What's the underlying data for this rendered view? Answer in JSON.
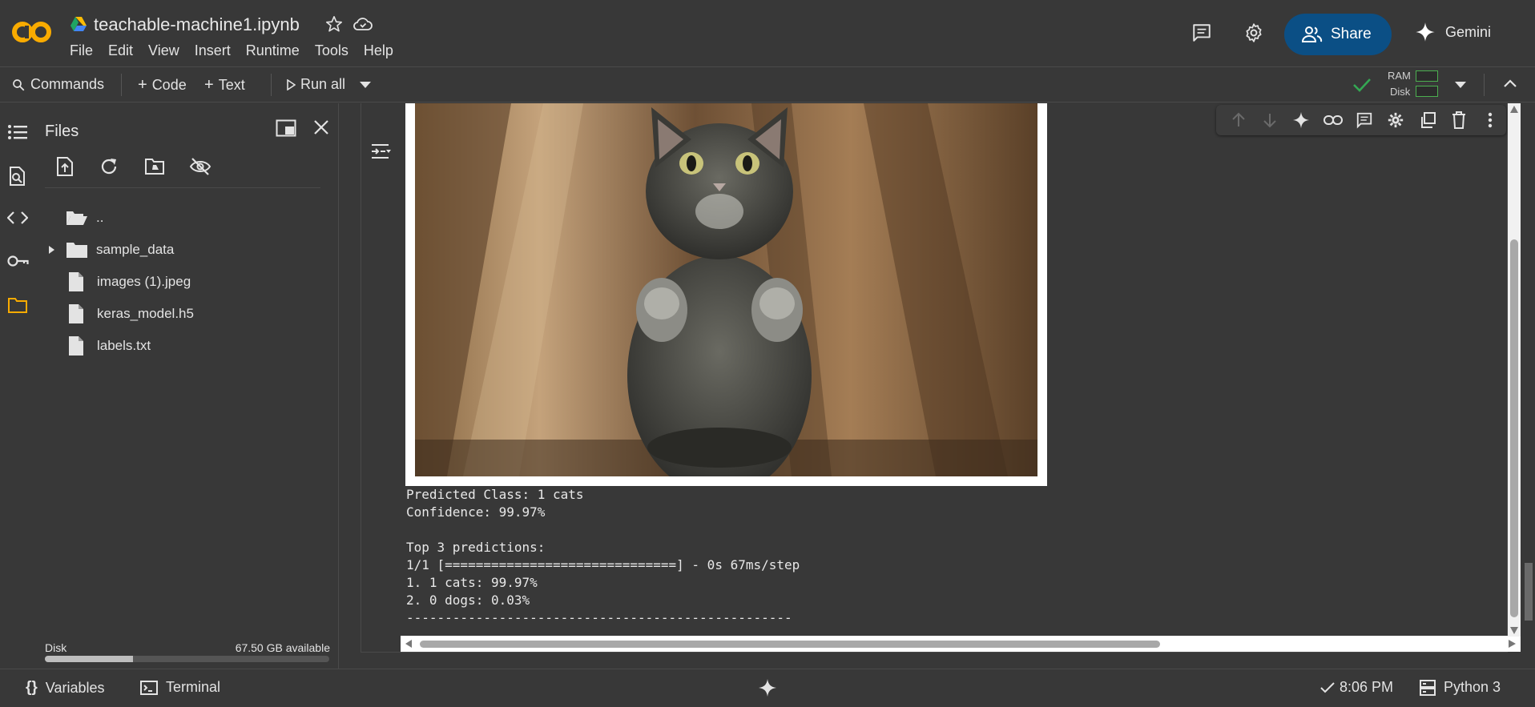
{
  "app": {
    "notebook_title": "teachable-machine1.ipynb",
    "logo_text": "CO",
    "brand_color": "#f9ab00",
    "share_color": "#0b4f85"
  },
  "menu": [
    "File",
    "Edit",
    "View",
    "Insert",
    "Runtime",
    "Tools",
    "Help"
  ],
  "header": {
    "share_label": "Share",
    "gemini_label": "Gemini",
    "icons": [
      "comment-icon",
      "settings-icon",
      "share-people-icon",
      "gemini-spark-icon"
    ]
  },
  "toolbar": {
    "commands_label": "Commands",
    "code_label": "Code",
    "text_label": "Text",
    "run_all_label": "Run all",
    "ram_label": "RAM",
    "disk_label": "Disk"
  },
  "files_panel": {
    "title": "Files",
    "tree": [
      {
        "name": "..",
        "kind": "folder-open"
      },
      {
        "name": "sample_data",
        "kind": "folder"
      },
      {
        "name": "images (1).jpeg",
        "kind": "file"
      },
      {
        "name": "keras_model.h5",
        "kind": "file"
      },
      {
        "name": "labels.txt",
        "kind": "file"
      }
    ],
    "disk_label": "Disk",
    "disk_available": "67.50 GB available",
    "disk_used_fraction": 0.31
  },
  "output": {
    "line1": "Predicted Class: 1 cats",
    "line2": "Confidence: 99.97%",
    "line3": "Top 3 predictions:",
    "line4": "1/1 [==============================] - 0s 67ms/step",
    "line5": "1. 1 cats: 99.97%",
    "line6": "2. 0 dogs: 0.03%",
    "line7": "--------------------------------------------------"
  },
  "status_bar": {
    "variables_label": "Variables",
    "terminal_label": "Terminal",
    "time": "8:06 PM",
    "kernel": "Python 3"
  }
}
